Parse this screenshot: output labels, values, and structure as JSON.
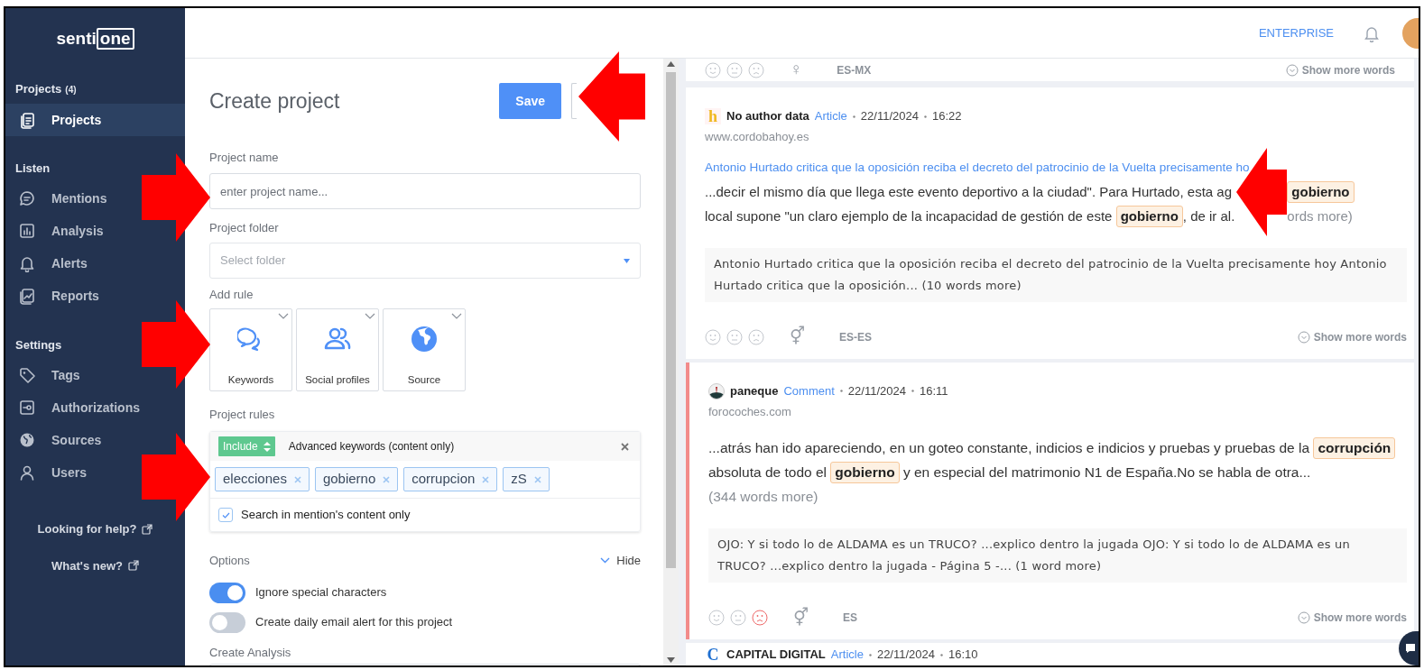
{
  "sidebar": {
    "logo": [
      "senti",
      "one"
    ],
    "sections": [
      {
        "title": "Projects",
        "count": "(4)",
        "items": [
          {
            "label": "Projects",
            "selected": true
          }
        ]
      },
      {
        "title": "Listen",
        "items": [
          {
            "label": "Mentions",
            "selected": false
          },
          {
            "label": "Analysis",
            "selected": false
          },
          {
            "label": "Alerts",
            "selected": false
          },
          {
            "label": "Reports",
            "selected": false
          }
        ]
      },
      {
        "title": "Settings",
        "items": [
          {
            "label": "Tags",
            "selected": false
          },
          {
            "label": "Authorizations",
            "selected": false
          },
          {
            "label": "Sources",
            "selected": false
          },
          {
            "label": "Users",
            "selected": false
          }
        ]
      }
    ],
    "links": [
      {
        "label": "Looking for help?"
      },
      {
        "label": "What's new?"
      }
    ]
  },
  "header": {
    "plan": "ENTERPRISE"
  },
  "form": {
    "title": "Create project",
    "save": "Save",
    "fields": [
      {
        "kind": "input",
        "label": "Project name",
        "placeholder": "enter project name..."
      },
      {
        "kind": "select",
        "label": "Project folder",
        "placeholder": "Select folder"
      }
    ],
    "add_rule": {
      "label": "Add rule",
      "options": [
        {
          "label": "Keywords"
        },
        {
          "label": "Social profiles"
        },
        {
          "label": "Source"
        }
      ]
    },
    "rules": {
      "label": "Project rules",
      "mode": "Include",
      "type": "Advanced keywords (content only)",
      "keywords": [
        "elecciones",
        "gobierno",
        "corrupcion",
        "zS"
      ],
      "content_only": {
        "label": "Search in mention's content only",
        "checked": true
      }
    },
    "options": {
      "label": "Options",
      "toggle": "Hide",
      "items": [
        {
          "label": "Ignore special characters",
          "on": true
        },
        {
          "label": "Create daily email alert for this project",
          "on": false
        }
      ]
    },
    "analysis_label": "Create Analysis"
  },
  "mentions": [
    {
      "kind": "partial-footer",
      "gender": "♀",
      "language": "ES-MX",
      "more": "Show more words"
    },
    {
      "kind": "full",
      "source_logo": "h",
      "author": "No author data",
      "type": "Article",
      "date": "22/11/2024",
      "time": "16:22",
      "site": "www.cordobahoy.es",
      "title": "Antonio Hurtado critica que la oposición reciba el decreto del patrocinio de la Vuelta precisamente ho",
      "body": [
        [
          {
            "kind": "text",
            "text": "...decir el mismo día que llega este evento deportivo a la ciudad\". Para Hurtado, esta ag"
          },
          {
            "kind": "covered"
          },
          {
            "kind": "keyword",
            "text": "gobierno"
          }
        ],
        [
          {
            "kind": "text",
            "text": "local supone \"un claro ejemplo de la incapacidad de gestión de este "
          },
          {
            "kind": "keyword",
            "text": "gobierno"
          },
          {
            "kind": "text",
            "text": ", de ir al."
          },
          {
            "kind": "covered"
          },
          {
            "kind": "more",
            "text": "ords more)"
          }
        ]
      ],
      "quote": "Antonio Hurtado critica que la oposición reciba el decreto del patrocinio de la Vuelta precisamente hoy Antonio Hurtado critica que la oposición... (10 words more)",
      "gender": "⚥",
      "language": "ES-ES",
      "more": "Show more words"
    },
    {
      "kind": "full",
      "flagged": true,
      "negative": true,
      "author": "paneque",
      "type": "Comment",
      "date": "22/11/2024",
      "time": "16:11",
      "site": "forocoches.com",
      "body": [
        [
          {
            "kind": "text",
            "text": "...atrás han ido apareciendo, en un goteo constante, indicios e indicios y pruebas y pruebas de la "
          },
          {
            "kind": "keyword",
            "text": "corrupción"
          },
          {
            "kind": "text",
            "text": " absoluta de todo el "
          },
          {
            "kind": "keyword",
            "text": "gobierno"
          },
          {
            "kind": "text",
            "text": " y en especial del matrimonio N1 de España.No se habla de otra..."
          },
          {
            "kind": "more",
            "text": " (344 words"
          },
          {
            "kind": "more",
            "text": " more)"
          }
        ]
      ],
      "quote": "OJO: Y si todo lo de ALDAMA es un TRUCO? ...explico dentro la jugada OJO: Y si todo lo de ALDAMA es un TRUCO? ...explico dentro la jugada - Página 5 -... (1 word more)",
      "gender": "⚥",
      "language": "ES",
      "more": "Show more words"
    },
    {
      "kind": "partial-header",
      "source_logo": "C",
      "author": "CAPITAL DIGITAL",
      "type": "Article",
      "date": "22/11/2024",
      "time": "16:10"
    }
  ],
  "annotations": [
    {
      "kind": "arrow",
      "points_left": true
    },
    {
      "kind": "arrow",
      "points_left": false
    },
    {
      "kind": "arrow",
      "points_left": false
    },
    {
      "kind": "arrow",
      "points_left": false
    },
    {
      "kind": "arrow",
      "points_left": true
    }
  ]
}
